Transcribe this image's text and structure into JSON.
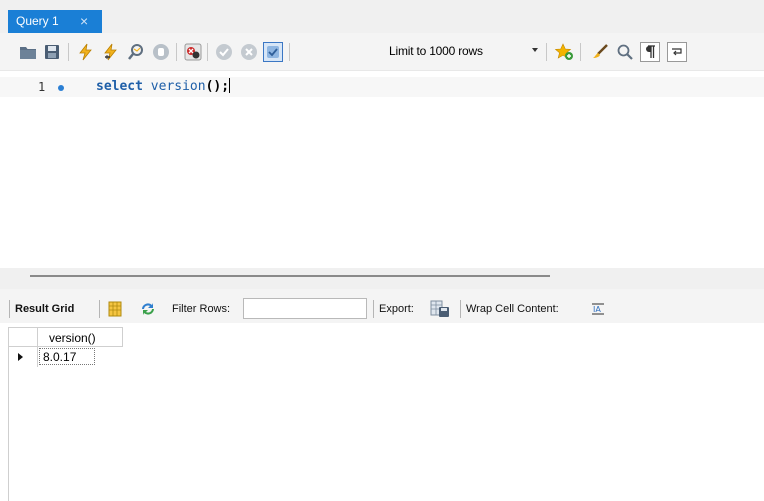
{
  "tab": {
    "title": "Query 1",
    "close_glyph": "×"
  },
  "toolbar": {
    "icons": [
      "open-folder-icon",
      "save-icon",
      "execute-icon",
      "execute-current-icon",
      "explain-icon",
      "stop-icon",
      "toggle-error-icon",
      "commit-icon",
      "rollback-icon",
      "autocommit-icon",
      "add-snippet-icon",
      "beautify-icon",
      "find-icon",
      "invisible-chars-icon",
      "word-wrap-icon"
    ],
    "limit_label": "Limit to 1000 rows"
  },
  "editor": {
    "line_number": "1",
    "code_keyword": "select",
    "code_function": "version",
    "code_parens": "();"
  },
  "result_toolbar": {
    "result_grid_label": "Result Grid",
    "filter_rows_label": "Filter Rows:",
    "filter_value": "",
    "export_label": "Export:",
    "wrap_label": "Wrap Cell Content:"
  },
  "grid": {
    "columns": [
      "version()"
    ],
    "rows": [
      [
        "8.0.17"
      ]
    ]
  },
  "colors": {
    "tab_active": "#1a7fd6",
    "keyword": "#1f5fa8",
    "line_marker": "#2b7fd4"
  }
}
